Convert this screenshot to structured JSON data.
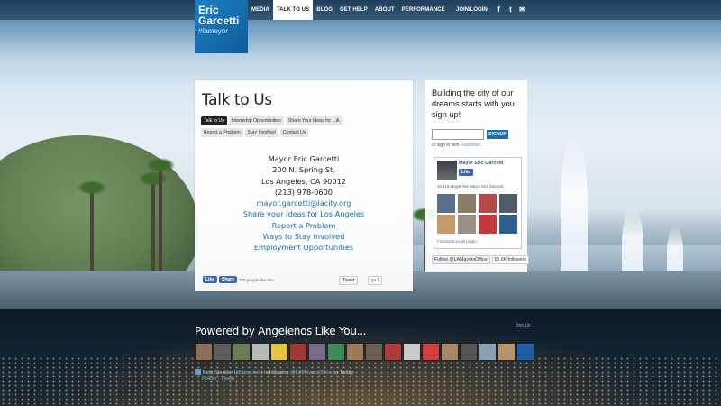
{
  "logo": {
    "line1": "Eric",
    "line2": "Garcetti",
    "tag": "#lamayor"
  },
  "nav": {
    "items": [
      "MEDIA",
      "TALK TO US",
      "BLOG",
      "GET HELP",
      "ABOUT",
      "PERFORMANCE"
    ],
    "active": "TALK TO US"
  },
  "account": {
    "join_login": "JOIN/LOGIN"
  },
  "social_icons": [
    "facebook-icon",
    "twitter-icon",
    "email-icon"
  ],
  "main": {
    "title": "Talk to Us",
    "tabs": [
      "Talk to Us",
      "Internship Opportunities",
      "Share Your Ideas for L.A.",
      "Report a Problem",
      "Stay Involved",
      "Contact Us"
    ],
    "address": [
      "Mayor Eric Garcetti",
      "200 N. Spring St.",
      "Los Angeles, CA 90012",
      "(213) 978-0600"
    ],
    "links": [
      "mayor.garcetti@lacity.org",
      "Share your ideas for Los Angeles",
      "Report a Problem",
      "Ways to Stay Involved",
      "Employment Opportunities"
    ],
    "share": {
      "like": "Like",
      "share": "Share",
      "count": "150 people like this.",
      "tweet": "Tweet",
      "gplus": "g+1"
    }
  },
  "signup": {
    "heading": "Building the city of our dreams starts with you, sign up!",
    "button": "SIGNUP",
    "or_sign_in": "or sign in with",
    "facebook": "Facebook."
  },
  "fb_box": {
    "page_name": "Mayor Eric Garcetti",
    "like": "Like",
    "count_prefix": "19,419 people like",
    "count_link": "Mayor Eric Garcetti.",
    "plugin": "Facebook social plugin"
  },
  "twitter_follow": {
    "label": "Follow @LAMayorsOffice",
    "count": "65.6K followers"
  },
  "footer": {
    "powered": "Powered by Angelenos Like You...",
    "join_us": "Join Us",
    "tweet_line1_a": "Beth Steckler (",
    "tweet_line1_user": "@bsteckler",
    "tweet_line1_b": ") is following ",
    "tweet_line1_target": "@LAMayorsOffice",
    "tweet_line1_c": " on Twitter",
    "tweet_actions": [
      "Follow",
      "Tweet"
    ]
  }
}
